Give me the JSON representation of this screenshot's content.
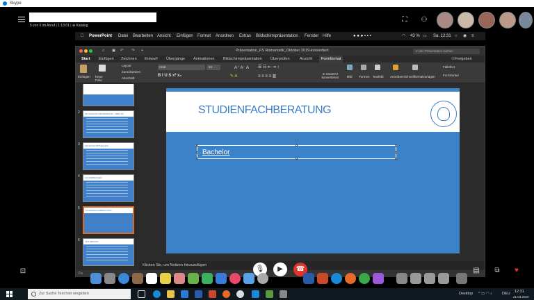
{
  "skype": {
    "window_title": "Skype",
    "call_info": "5 von 6 im Anruf  |  1:13:01  |  ⊕ Katalog",
    "fullscreen_icon": "expand-icon",
    "add_person_icon": "add-person-icon"
  },
  "mac_menu": {
    "apple": "",
    "app": "PowerPoint",
    "items": [
      "Datei",
      "Bearbeiten",
      "Ansicht",
      "Einfügen",
      "Format",
      "Anordnen",
      "Extras",
      "Bildschirmpräsentation",
      "Fenster",
      "Hilfe"
    ],
    "battery": "43 %",
    "clock": "Sa. 12:31"
  },
  "ppt": {
    "doc_title": "Präsentation_FS Romanistik_Oktober 2019-konvertiert",
    "search_placeholder": "In der Präsentation suchen",
    "tabs": [
      "Start",
      "Einfügen",
      "Zeichnen",
      "Entwurf",
      "Übergänge",
      "Animationen",
      "Bildschirmpräsentation",
      "Überprüfen",
      "Ansicht",
      "Formformat"
    ],
    "share_label": "Freigeben",
    "ribbon": {
      "paste": "Einfügen",
      "new_slide": "Neue Folie",
      "layout": "Layout",
      "reset": "Zurücksetzen",
      "section": "Abschnitt",
      "font": "Arial",
      "font_size": "24",
      "smartart": "In SmartArt konvertieren",
      "picture": "Bild",
      "shapes": "Formen",
      "textbox": "Textfeld",
      "arrange": "Anordnen",
      "quickstyles": "Schnellformatvorlagen",
      "fill": "Füllefect",
      "outline": "Formkontur"
    },
    "thumbnails": [
      {
        "num": "",
        "title": ""
      },
      {
        "num": "2",
        "title": "FACHSCHAFTSROMANISTIK - WER IST..."
      },
      {
        "num": "3",
        "title": "WICHTIGE MITTEILUNG"
      },
      {
        "num": "4",
        "title": "FACHSPRACHEN"
      },
      {
        "num": "5",
        "title": "STUDIENFACHBERATUNG"
      },
      {
        "num": "6",
        "title": "LINK-BERATE"
      }
    ],
    "slide": {
      "title": "STUDIENFACHBERATUNG",
      "textbox": "Bachelor"
    },
    "notes_placeholder": "Klicken Sie, um Notizen hinzuzufügen",
    "status": "Fo"
  },
  "taskbar": {
    "search_placeholder": "Zur Suche Text hier eingeben",
    "desktop_label": "Desktop",
    "lang": "DEU",
    "time": "12:31",
    "date": "21.03.2020"
  },
  "colors": {
    "slide_blue": "#3b82c9",
    "accent_orange": "#e06a2a",
    "hangup_red": "#e0342a",
    "heart_red": "#e8352f"
  }
}
